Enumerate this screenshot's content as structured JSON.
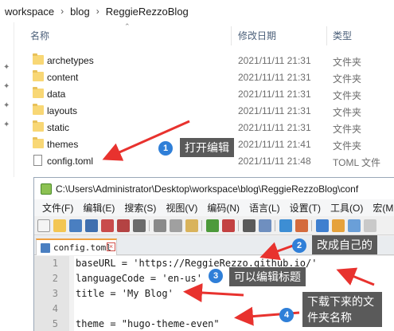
{
  "explorer": {
    "breadcrumb": [
      "workspace",
      "blog",
      "ReggieRezzoBlog"
    ],
    "columns": {
      "name": "名称",
      "modified": "修改日期",
      "type": "类型"
    },
    "files": [
      {
        "name": "archetypes",
        "modified": "2021/11/11 21:31",
        "type": "文件夹",
        "icon": "folder-icon"
      },
      {
        "name": "content",
        "modified": "2021/11/11 21:31",
        "type": "文件夹",
        "icon": "folder-icon"
      },
      {
        "name": "data",
        "modified": "2021/11/11 21:31",
        "type": "文件夹",
        "icon": "folder-icon"
      },
      {
        "name": "layouts",
        "modified": "2021/11/11 21:31",
        "type": "文件夹",
        "icon": "folder-icon"
      },
      {
        "name": "static",
        "modified": "2021/11/11 21:31",
        "type": "文件夹",
        "icon": "folder-icon"
      },
      {
        "name": "themes",
        "modified": "2021/11/11 21:41",
        "type": "文件夹",
        "icon": "folder-icon"
      },
      {
        "name": "config.toml",
        "modified": "2021/11/11 21:48",
        "type": "TOML 文件",
        "icon": "document-icon"
      }
    ]
  },
  "editor": {
    "title": "C:\\Users\\Administrator\\Desktop\\workspace\\blog\\ReggieRezzoBlog\\conf",
    "menu": [
      "文件(F)",
      "编辑(E)",
      "搜索(S)",
      "视图(V)",
      "编码(N)",
      "语言(L)",
      "设置(T)",
      "工具(O)",
      "宏(M"
    ],
    "tab_label": "config.toml",
    "lines": [
      {
        "no": "1",
        "text": "baseURL = 'https://ReggieRezzo.github.io/'"
      },
      {
        "no": "2",
        "text": "languageCode = 'en-us'"
      },
      {
        "no": "3",
        "text": "title = 'My Blog'"
      },
      {
        "no": "4",
        "text": ""
      },
      {
        "no": "5",
        "text": "theme = \"hugo-theme-even\""
      }
    ]
  },
  "annotations": [
    {
      "num": "1",
      "label": "打开编辑"
    },
    {
      "num": "2",
      "label": "改成自己的"
    },
    {
      "num": "3",
      "label": "可以编辑标题"
    },
    {
      "num": "4",
      "label": "下载下来的文件夹名称"
    }
  ],
  "colors": {
    "arrow": "#e8322e",
    "badge": "#2f7fd8",
    "label_bg": "#5a5a5a",
    "folder": "#f8d775"
  }
}
